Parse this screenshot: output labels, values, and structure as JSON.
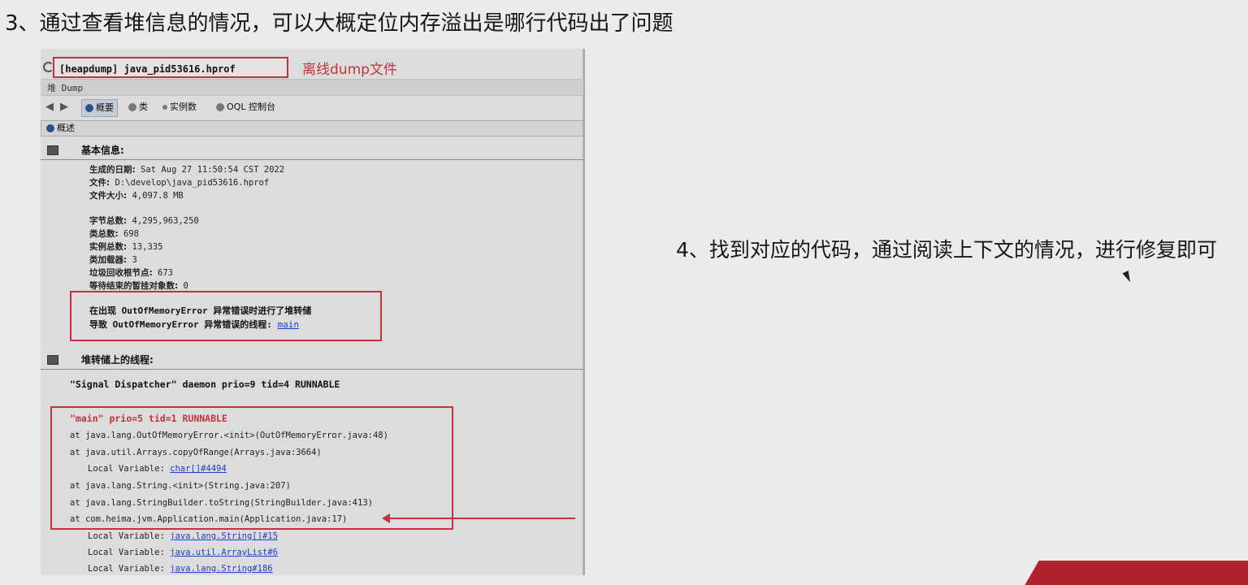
{
  "heading": "3、通过查看堆信息的情况，可以大概定位内存溢出是哪行代码出了问题",
  "right_note": "4、找到对应的代码，通过阅读上下文的情况，进行修复即可",
  "screenshot": {
    "file_tab": "[heapdump] java_pid53616.hprof",
    "offline_label": "离线dump文件",
    "heap_bar": "堆 Dump",
    "toolbar": {
      "overview": "概要",
      "classes": "类",
      "instances": "实例数",
      "oql": "OQL 控制台"
    },
    "overview_tab": "概述",
    "basic_info_title": "基本信息:",
    "basic_info": [
      {
        "label": "生成的日期:",
        "value": "Sat Aug 27 11:50:54 CST 2022"
      },
      {
        "label": "文件:",
        "value": "D:\\develop\\java_pid53616.hprof"
      },
      {
        "label": "文件大小:",
        "value": "4,097.8 MB"
      }
    ],
    "stats": [
      {
        "label": "字节总数:",
        "value": "4,295,963,250"
      },
      {
        "label": "类总数:",
        "value": "698"
      },
      {
        "label": "实例总数:",
        "value": "13,335"
      },
      {
        "label": "类加载器:",
        "value": "3"
      },
      {
        "label": "垃圾回收根节点:",
        "value": "673"
      },
      {
        "label": "等待结束的暂挂对象数:",
        "value": "0"
      }
    ],
    "oom_line1": "在出现 OutOfMemoryError 异常错误时进行了堆转储",
    "oom_line2_prefix": "导致 OutOfMemoryError 异常错误的线程:",
    "oom_thread_link": "main",
    "threads_title": "堆转储上的线程:",
    "signal_thread": "\"Signal Dispatcher\" daemon prio=9 tid=4 RUNNABLE",
    "main_thread": "\"main\" prio=5 tid=1 RUNNABLE",
    "stack": [
      "at java.lang.OutOfMemoryError.<init>(OutOfMemoryError.java:48)",
      "at java.util.Arrays.copyOfRange(Arrays.java:3664)",
      "at java.lang.String.<init>(String.java:207)",
      "at java.lang.StringBuilder.toString(StringBuilder.java:413)",
      "at com.heima.jvm.Application.main(Application.java:17)"
    ],
    "local_var_label": "Local Variable:",
    "local_vars": [
      "char[]#4494",
      "java.lang.String[]#15",
      "java.util.ArrayList#6",
      "java.lang.String#186"
    ]
  }
}
